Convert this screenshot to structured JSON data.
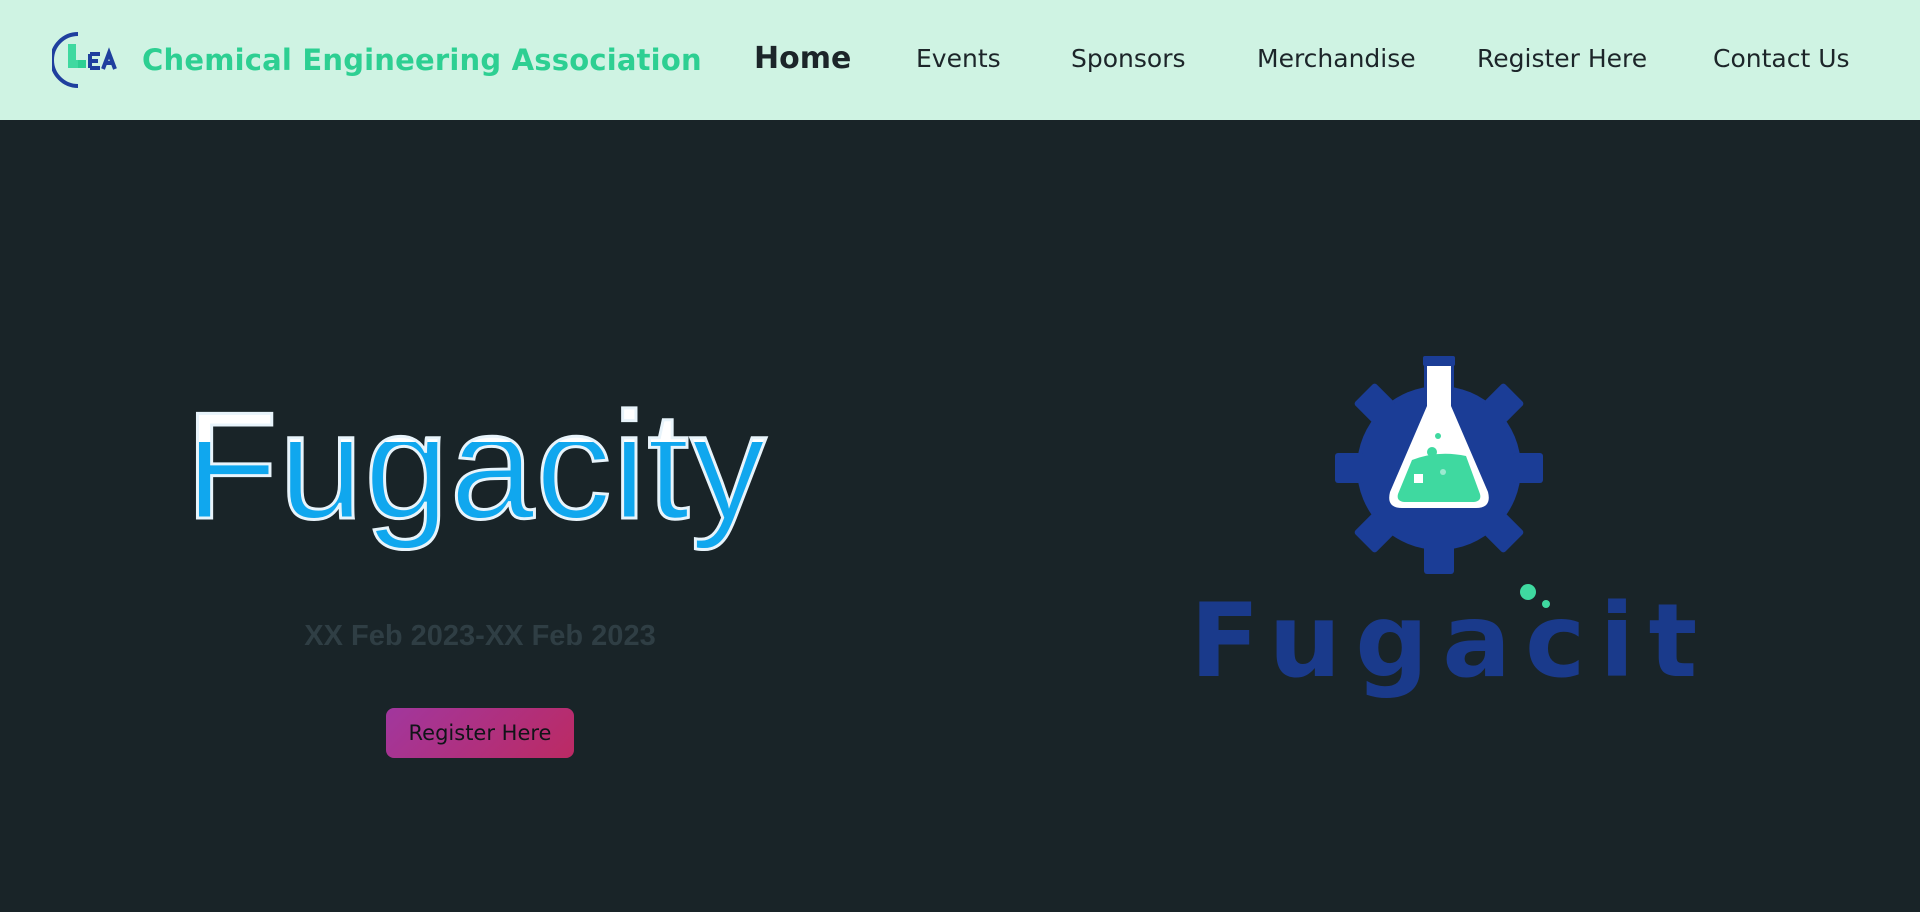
{
  "navbar": {
    "brand_name": "Chemical Engineering Association",
    "logo_text": "CEA",
    "links": [
      {
        "label": "Home",
        "active": true
      },
      {
        "label": "Events",
        "active": false
      },
      {
        "label": "Sponsors",
        "active": false
      },
      {
        "label": "Merchandise",
        "active": false
      },
      {
        "label": "Register Here",
        "active": false
      },
      {
        "label": "Contact Us",
        "active": false
      }
    ]
  },
  "hero": {
    "title": "Fugacity",
    "date": "XX Feb 2023-XX Feb 2023",
    "register_label": "Register Here",
    "logo_wordmark": "Fugacity"
  },
  "colors": {
    "navbar_bg": "#cff3e3",
    "brand_green": "#2dcf92",
    "hero_bg": "#192428",
    "title_blue": "#10a7ee",
    "logo_blue": "#1b3d96",
    "logo_mint": "#3fd9a0",
    "button_gradient_start": "#a1379e",
    "button_gradient_end": "#bc2a63"
  }
}
